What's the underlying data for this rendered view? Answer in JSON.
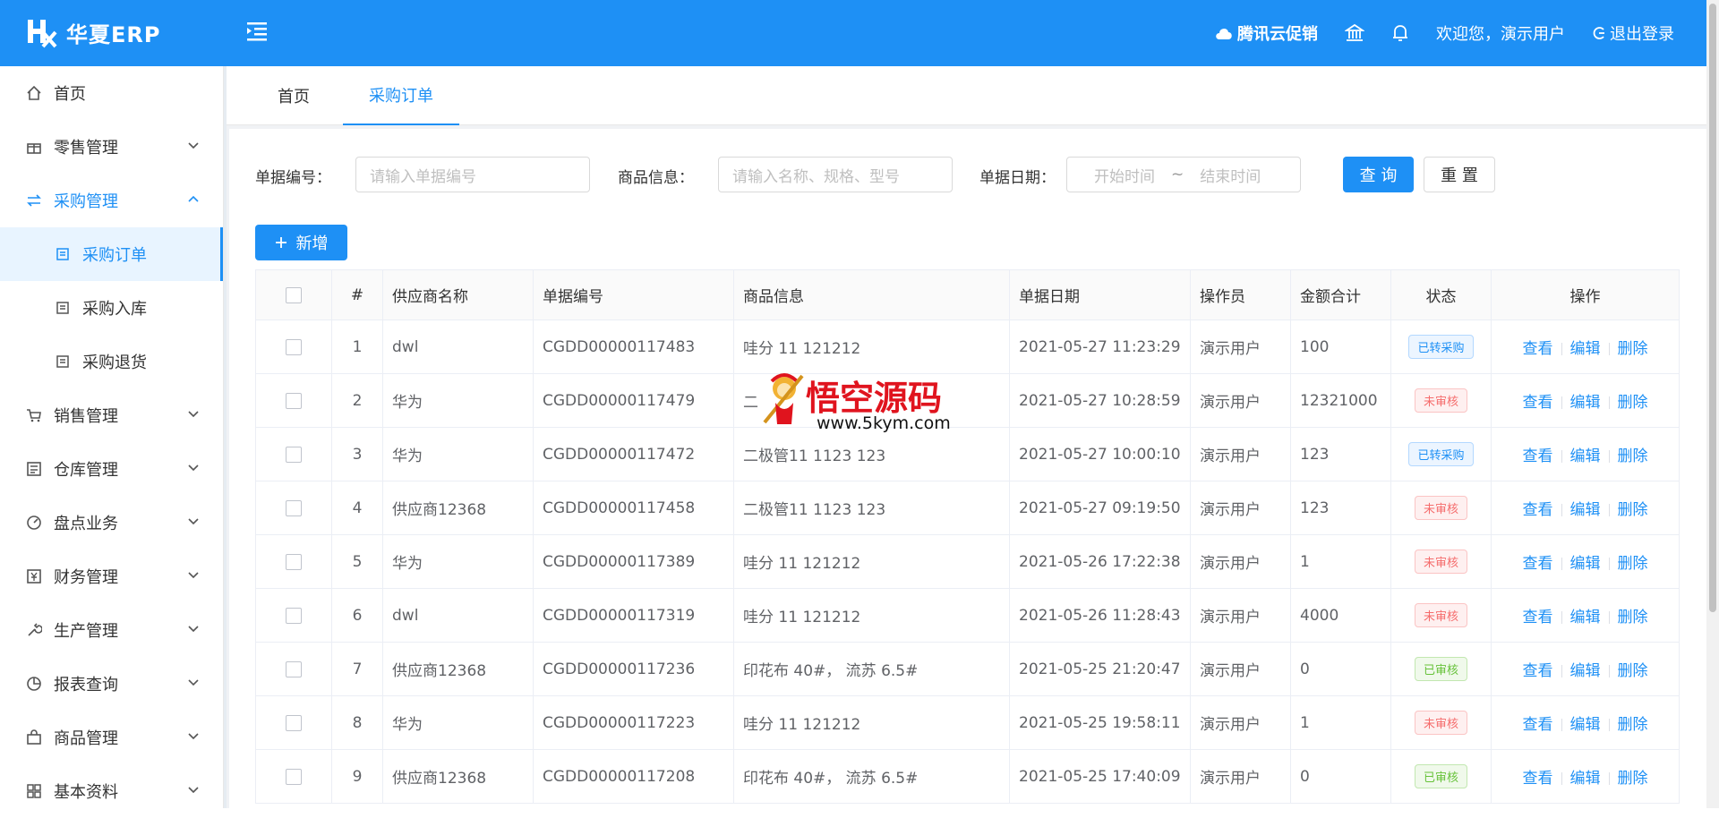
{
  "app": {
    "title": "华夏ERP"
  },
  "header": {
    "cloud_promo": "腾讯云促销",
    "welcome": "欢迎您，演示用户",
    "logout": "退出登录",
    "icons": [
      "menu-fold-icon",
      "bank-icon",
      "bell-icon",
      "cloud-icon",
      "logout-icon"
    ]
  },
  "sidebar": {
    "items": [
      {
        "label": "首页",
        "icon": "home-icon"
      },
      {
        "label": "零售管理",
        "icon": "gift-icon"
      },
      {
        "label": "采购管理",
        "icon": "swap-icon"
      },
      {
        "label": "采购订单",
        "icon": "document-icon"
      },
      {
        "label": "采购入库",
        "icon": "document-icon"
      },
      {
        "label": "采购退货",
        "icon": "document-icon"
      },
      {
        "label": "销售管理",
        "icon": "cart-icon"
      },
      {
        "label": "仓库管理",
        "icon": "warehouse-icon"
      },
      {
        "label": "盘点业务",
        "icon": "dashboard-icon"
      },
      {
        "label": "财务管理",
        "icon": "finance-icon"
      },
      {
        "label": "生产管理",
        "icon": "tool-icon"
      },
      {
        "label": "报表查询",
        "icon": "pie-chart-icon"
      },
      {
        "label": "商品管理",
        "icon": "shopping-bag-icon"
      },
      {
        "label": "基本资料",
        "icon": "appstore-icon"
      }
    ]
  },
  "tabs": [
    {
      "label": "首页"
    },
    {
      "label": "采购订单"
    }
  ],
  "filters": {
    "bill_no_label": "单据编号：",
    "bill_no_placeholder": "请输入单据编号",
    "goods_label": "商品信息：",
    "goods_placeholder": "请输入名称、规格、型号",
    "date_label": "单据日期：",
    "date_start": "开始时间",
    "date_sep": "~",
    "date_end": "结束时间",
    "query": "查 询",
    "reset": "重 置"
  },
  "add_button": "新增",
  "table": {
    "headers": [
      "#",
      "供应商名称",
      "单据编号",
      "商品信息",
      "单据日期",
      "操作员",
      "金额合计",
      "状态",
      "操作"
    ],
    "rows": [
      {
        "no": "1",
        "supplier": "dwl",
        "bill": "CGDD00000117483",
        "goods": "哇分 11 121212",
        "date": "2021-05-27 11:23:29",
        "op": "演示用户",
        "amount": "100",
        "status": "已转采购",
        "status_color": "#1e90f5"
      },
      {
        "no": "2",
        "supplier": "华为",
        "bill": "CGDD00000117479",
        "goods": "二",
        "date": "2021-05-27 10:28:59",
        "op": "演示用户",
        "amount": "12321000",
        "status": "未审核",
        "status_color": "#f56c6c"
      },
      {
        "no": "3",
        "supplier": "华为",
        "bill": "CGDD00000117472",
        "goods": "二极管11 1123 123",
        "date": "2021-05-27 10:00:10",
        "op": "演示用户",
        "amount": "123",
        "status": "已转采购",
        "status_color": "#1e90f5"
      },
      {
        "no": "4",
        "supplier": "供应商12368",
        "bill": "CGDD00000117458",
        "goods": "二极管11 1123 123",
        "date": "2021-05-27 09:19:50",
        "op": "演示用户",
        "amount": "123",
        "status": "未审核",
        "status_color": "#f56c6c"
      },
      {
        "no": "5",
        "supplier": "华为",
        "bill": "CGDD00000117389",
        "goods": "哇分 11 121212",
        "date": "2021-05-26 17:22:38",
        "op": "演示用户",
        "amount": "1",
        "status": "未审核",
        "status_color": "#f56c6c"
      },
      {
        "no": "6",
        "supplier": "dwl",
        "bill": "CGDD00000117319",
        "goods": "哇分 11 121212",
        "date": "2021-05-26 11:28:43",
        "op": "演示用户",
        "amount": "4000",
        "status": "未审核",
        "status_color": "#f56c6c"
      },
      {
        "no": "7",
        "supplier": "供应商12368",
        "bill": "CGDD00000117236",
        "goods": "印花布 40#， 流苏 6.5#",
        "date": "2021-05-25 21:20:47",
        "op": "演示用户",
        "amount": "0",
        "status": "已审核",
        "status_color": "#67c23a"
      },
      {
        "no": "8",
        "supplier": "华为",
        "bill": "CGDD00000117223",
        "goods": "哇分 11 121212",
        "date": "2021-05-25 19:58:11",
        "op": "演示用户",
        "amount": "1",
        "status": "未审核",
        "status_color": "#f56c6c"
      },
      {
        "no": "9",
        "supplier": "供应商12368",
        "bill": "CGDD00000117208",
        "goods": "印花布 40#， 流苏 6.5#",
        "date": "2021-05-25 17:40:09",
        "op": "演示用户",
        "amount": "0",
        "status": "已审核",
        "status_color": "#67c23a"
      }
    ],
    "actions": [
      "查看",
      "编辑",
      "删除"
    ]
  },
  "watermark": {
    "title": "悟空源码",
    "url": "www.5kym.com"
  },
  "colors": {
    "primary": "#1e90f5",
    "danger": "#f56c6c",
    "success": "#67c23a"
  }
}
